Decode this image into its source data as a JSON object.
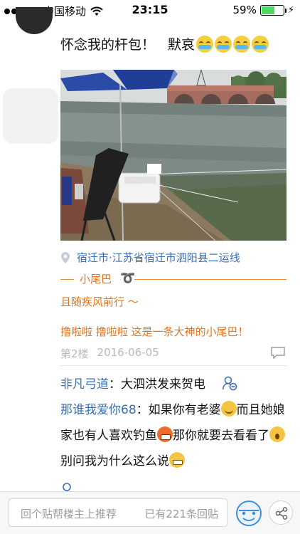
{
  "status_bar": {
    "carrier": "中国移动",
    "time": "23:15",
    "battery": "59%",
    "battery_level": 0.59,
    "signal_bars_filled": 4
  },
  "post": {
    "text": "怀念我的杆包！",
    "text_2": "默哀",
    "emoji_count": 4,
    "location": "宿迁市·江苏省宿迁市泗阳县二运线"
  },
  "tail": {
    "label": "小尾巴",
    "motto": "且随疾风前行 ～",
    "slogan": "撸啦啦  撸啦啦  这是一条大神的小尾巴！"
  },
  "floor": {
    "number": "第2楼",
    "date": "2016-06-05"
  },
  "comments": [
    {
      "user": "非凡弓道",
      "sep": "：",
      "text": "大泗洪发来贺电"
    },
    {
      "user": "那谁我爱你68",
      "sep": "：",
      "part1": "如果你有老婆",
      "part2": "而且她娘家也有人喜欢钓鱼",
      "part3": "那你就要去看看了",
      "part4": "别问我为什么这么说"
    }
  ],
  "bottom": {
    "reply_placeholder": "回个贴帮楼主上推荐",
    "reply_count": "已有221条回贴"
  },
  "colors": {
    "link_blue": "#3b6fb5",
    "tail_orange": "#e8751a",
    "meta_gray": "#b9b9b9"
  }
}
